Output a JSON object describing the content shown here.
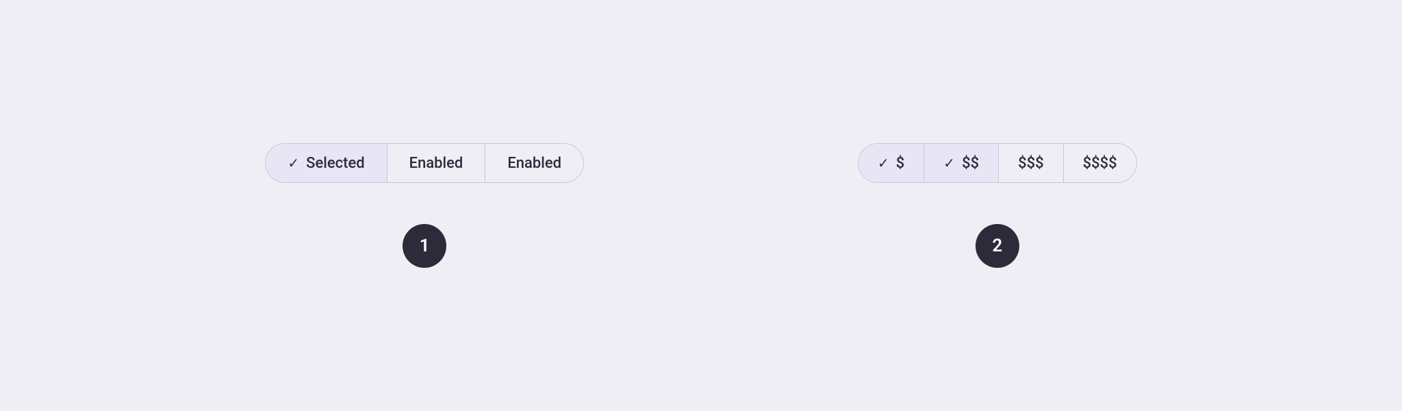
{
  "background_color": "#f0eef5",
  "example1": {
    "segments": [
      {
        "id": "selected",
        "label": "Selected",
        "check": true,
        "state": "selected"
      },
      {
        "id": "enabled1",
        "label": "Enabled",
        "check": false,
        "state": "enabled"
      },
      {
        "id": "enabled2",
        "label": "Enabled",
        "check": false,
        "state": "enabled"
      }
    ],
    "badge": "1"
  },
  "example2": {
    "segments": [
      {
        "id": "dollar1",
        "label": "$",
        "check": true,
        "state": "selected"
      },
      {
        "id": "dollar2",
        "label": "$$",
        "check": true,
        "state": "selected"
      },
      {
        "id": "dollar3",
        "label": "$$$",
        "check": false,
        "state": "enabled"
      },
      {
        "id": "dollar4",
        "label": "$$$$",
        "check": false,
        "state": "enabled"
      }
    ],
    "badge": "2"
  },
  "icons": {
    "check": "✓"
  }
}
